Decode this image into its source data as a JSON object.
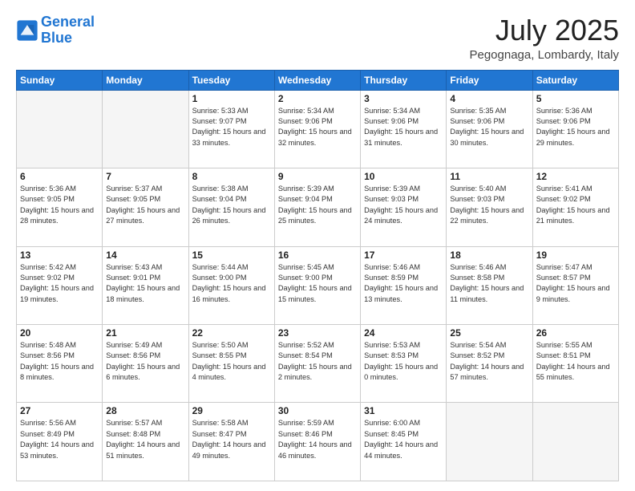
{
  "header": {
    "logo_line1": "General",
    "logo_line2": "Blue",
    "month": "July 2025",
    "location": "Pegognaga, Lombardy, Italy"
  },
  "weekdays": [
    "Sunday",
    "Monday",
    "Tuesday",
    "Wednesday",
    "Thursday",
    "Friday",
    "Saturday"
  ],
  "weeks": [
    [
      {
        "day": "",
        "sunrise": "",
        "sunset": "",
        "daylight": ""
      },
      {
        "day": "",
        "sunrise": "",
        "sunset": "",
        "daylight": ""
      },
      {
        "day": "1",
        "sunrise": "Sunrise: 5:33 AM",
        "sunset": "Sunset: 9:07 PM",
        "daylight": "Daylight: 15 hours and 33 minutes."
      },
      {
        "day": "2",
        "sunrise": "Sunrise: 5:34 AM",
        "sunset": "Sunset: 9:06 PM",
        "daylight": "Daylight: 15 hours and 32 minutes."
      },
      {
        "day": "3",
        "sunrise": "Sunrise: 5:34 AM",
        "sunset": "Sunset: 9:06 PM",
        "daylight": "Daylight: 15 hours and 31 minutes."
      },
      {
        "day": "4",
        "sunrise": "Sunrise: 5:35 AM",
        "sunset": "Sunset: 9:06 PM",
        "daylight": "Daylight: 15 hours and 30 minutes."
      },
      {
        "day": "5",
        "sunrise": "Sunrise: 5:36 AM",
        "sunset": "Sunset: 9:06 PM",
        "daylight": "Daylight: 15 hours and 29 minutes."
      }
    ],
    [
      {
        "day": "6",
        "sunrise": "Sunrise: 5:36 AM",
        "sunset": "Sunset: 9:05 PM",
        "daylight": "Daylight: 15 hours and 28 minutes."
      },
      {
        "day": "7",
        "sunrise": "Sunrise: 5:37 AM",
        "sunset": "Sunset: 9:05 PM",
        "daylight": "Daylight: 15 hours and 27 minutes."
      },
      {
        "day": "8",
        "sunrise": "Sunrise: 5:38 AM",
        "sunset": "Sunset: 9:04 PM",
        "daylight": "Daylight: 15 hours and 26 minutes."
      },
      {
        "day": "9",
        "sunrise": "Sunrise: 5:39 AM",
        "sunset": "Sunset: 9:04 PM",
        "daylight": "Daylight: 15 hours and 25 minutes."
      },
      {
        "day": "10",
        "sunrise": "Sunrise: 5:39 AM",
        "sunset": "Sunset: 9:03 PM",
        "daylight": "Daylight: 15 hours and 24 minutes."
      },
      {
        "day": "11",
        "sunrise": "Sunrise: 5:40 AM",
        "sunset": "Sunset: 9:03 PM",
        "daylight": "Daylight: 15 hours and 22 minutes."
      },
      {
        "day": "12",
        "sunrise": "Sunrise: 5:41 AM",
        "sunset": "Sunset: 9:02 PM",
        "daylight": "Daylight: 15 hours and 21 minutes."
      }
    ],
    [
      {
        "day": "13",
        "sunrise": "Sunrise: 5:42 AM",
        "sunset": "Sunset: 9:02 PM",
        "daylight": "Daylight: 15 hours and 19 minutes."
      },
      {
        "day": "14",
        "sunrise": "Sunrise: 5:43 AM",
        "sunset": "Sunset: 9:01 PM",
        "daylight": "Daylight: 15 hours and 18 minutes."
      },
      {
        "day": "15",
        "sunrise": "Sunrise: 5:44 AM",
        "sunset": "Sunset: 9:00 PM",
        "daylight": "Daylight: 15 hours and 16 minutes."
      },
      {
        "day": "16",
        "sunrise": "Sunrise: 5:45 AM",
        "sunset": "Sunset: 9:00 PM",
        "daylight": "Daylight: 15 hours and 15 minutes."
      },
      {
        "day": "17",
        "sunrise": "Sunrise: 5:46 AM",
        "sunset": "Sunset: 8:59 PM",
        "daylight": "Daylight: 15 hours and 13 minutes."
      },
      {
        "day": "18",
        "sunrise": "Sunrise: 5:46 AM",
        "sunset": "Sunset: 8:58 PM",
        "daylight": "Daylight: 15 hours and 11 minutes."
      },
      {
        "day": "19",
        "sunrise": "Sunrise: 5:47 AM",
        "sunset": "Sunset: 8:57 PM",
        "daylight": "Daylight: 15 hours and 9 minutes."
      }
    ],
    [
      {
        "day": "20",
        "sunrise": "Sunrise: 5:48 AM",
        "sunset": "Sunset: 8:56 PM",
        "daylight": "Daylight: 15 hours and 8 minutes."
      },
      {
        "day": "21",
        "sunrise": "Sunrise: 5:49 AM",
        "sunset": "Sunset: 8:56 PM",
        "daylight": "Daylight: 15 hours and 6 minutes."
      },
      {
        "day": "22",
        "sunrise": "Sunrise: 5:50 AM",
        "sunset": "Sunset: 8:55 PM",
        "daylight": "Daylight: 15 hours and 4 minutes."
      },
      {
        "day": "23",
        "sunrise": "Sunrise: 5:52 AM",
        "sunset": "Sunset: 8:54 PM",
        "daylight": "Daylight: 15 hours and 2 minutes."
      },
      {
        "day": "24",
        "sunrise": "Sunrise: 5:53 AM",
        "sunset": "Sunset: 8:53 PM",
        "daylight": "Daylight: 15 hours and 0 minutes."
      },
      {
        "day": "25",
        "sunrise": "Sunrise: 5:54 AM",
        "sunset": "Sunset: 8:52 PM",
        "daylight": "Daylight: 14 hours and 57 minutes."
      },
      {
        "day": "26",
        "sunrise": "Sunrise: 5:55 AM",
        "sunset": "Sunset: 8:51 PM",
        "daylight": "Daylight: 14 hours and 55 minutes."
      }
    ],
    [
      {
        "day": "27",
        "sunrise": "Sunrise: 5:56 AM",
        "sunset": "Sunset: 8:49 PM",
        "daylight": "Daylight: 14 hours and 53 minutes."
      },
      {
        "day": "28",
        "sunrise": "Sunrise: 5:57 AM",
        "sunset": "Sunset: 8:48 PM",
        "daylight": "Daylight: 14 hours and 51 minutes."
      },
      {
        "day": "29",
        "sunrise": "Sunrise: 5:58 AM",
        "sunset": "Sunset: 8:47 PM",
        "daylight": "Daylight: 14 hours and 49 minutes."
      },
      {
        "day": "30",
        "sunrise": "Sunrise: 5:59 AM",
        "sunset": "Sunset: 8:46 PM",
        "daylight": "Daylight: 14 hours and 46 minutes."
      },
      {
        "day": "31",
        "sunrise": "Sunrise: 6:00 AM",
        "sunset": "Sunset: 8:45 PM",
        "daylight": "Daylight: 14 hours and 44 minutes."
      },
      {
        "day": "",
        "sunrise": "",
        "sunset": "",
        "daylight": ""
      },
      {
        "day": "",
        "sunrise": "",
        "sunset": "",
        "daylight": ""
      }
    ]
  ]
}
